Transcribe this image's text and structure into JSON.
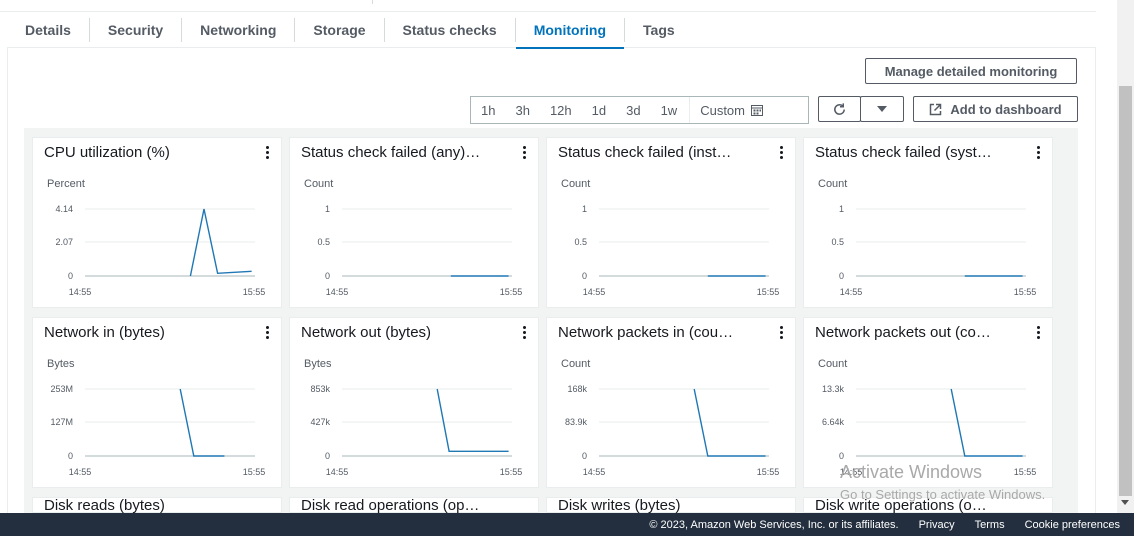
{
  "tabs": [
    {
      "label": "Details"
    },
    {
      "label": "Security"
    },
    {
      "label": "Networking"
    },
    {
      "label": "Storage"
    },
    {
      "label": "Status checks"
    },
    {
      "label": "Monitoring",
      "active": true
    },
    {
      "label": "Tags"
    }
  ],
  "toolbar": {
    "manage_label": "Manage detailed monitoring",
    "time_ranges": [
      "1h",
      "3h",
      "12h",
      "1d",
      "3d",
      "1w"
    ],
    "custom_label": "Custom",
    "add_dashboard_label": "Add to dashboard"
  },
  "widgets": [
    {
      "title": "CPU utilization (%)",
      "unit": "Percent",
      "y_ticks": [
        "4.14",
        "2.07",
        "0"
      ],
      "x_ticks": [
        "14:55",
        "15:55"
      ]
    },
    {
      "title": "Status check failed (any)…",
      "unit": "Count",
      "y_ticks": [
        "1",
        "0.5",
        "0"
      ],
      "x_ticks": [
        "14:55",
        "15:55"
      ]
    },
    {
      "title": "Status check failed (inst…",
      "unit": "Count",
      "y_ticks": [
        "1",
        "0.5",
        "0"
      ],
      "x_ticks": [
        "14:55",
        "15:55"
      ]
    },
    {
      "title": "Status check failed (syst…",
      "unit": "Count",
      "y_ticks": [
        "1",
        "0.5",
        "0"
      ],
      "x_ticks": [
        "14:55",
        "15:55"
      ]
    },
    {
      "title": "Network in (bytes)",
      "unit": "Bytes",
      "y_ticks": [
        "253M",
        "127M",
        "0"
      ],
      "x_ticks": [
        "14:55",
        "15:55"
      ]
    },
    {
      "title": "Network out (bytes)",
      "unit": "Bytes",
      "y_ticks": [
        "853k",
        "427k",
        "0"
      ],
      "x_ticks": [
        "14:55",
        "15:55"
      ]
    },
    {
      "title": "Network packets in (cou…",
      "unit": "Count",
      "y_ticks": [
        "168k",
        "83.9k",
        "0"
      ],
      "x_ticks": [
        "14:55",
        "15:55"
      ]
    },
    {
      "title": "Network packets out (co…",
      "unit": "Count",
      "y_ticks": [
        "13.3k",
        "6.64k",
        "0"
      ],
      "x_ticks": [
        "14:55",
        "15:55"
      ]
    }
  ],
  "partial_widgets": [
    "Disk reads (bytes)",
    "Disk read operations (op…",
    "Disk writes (bytes)",
    "Disk write operations (o…"
  ],
  "footer": {
    "copyright": "© 2023, Amazon Web Services, Inc. or its affiliates.",
    "privacy": "Privacy",
    "terms": "Terms",
    "cookie": "Cookie preferences"
  },
  "watermark": {
    "line1": "Activate Windows",
    "line2": "Go to Settings to activate Windows."
  },
  "colors": {
    "accent": "#0073bb",
    "series": "#1f77b4",
    "footer_bg": "#232f3e"
  },
  "icons": [
    "refresh-icon",
    "caret-down-icon",
    "external-link-icon",
    "calendar-icon",
    "more-vertical-icon"
  ]
}
